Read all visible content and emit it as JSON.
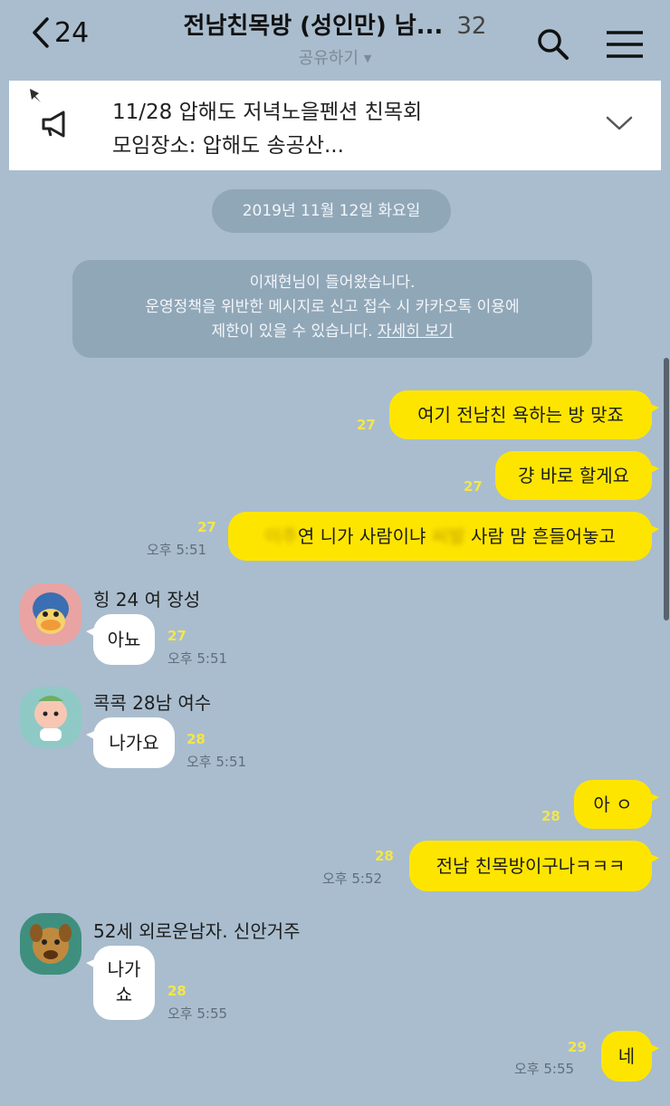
{
  "header": {
    "back_count": "24",
    "title": "전남친목방 (성인만) 남...",
    "member_count": "32",
    "share_label": "공유하기",
    "share_caret": "▼"
  },
  "notice": {
    "line1": "11/28 압해도 저녁노을펜션 친목회",
    "line2": "모임장소: 압해도 송공산..."
  },
  "date_divider": "2019년 11월 12일 화요일",
  "system_notice": {
    "line1": "이재현님이 들어왔습니다.",
    "line2": "운영정책을 위반한 메시지로 신고 접수 시 카카오톡 이용에",
    "line3_prefix": "제한이 있을 수 있습니다.",
    "line3_link": "자세히 보기"
  },
  "messages": {
    "m1": {
      "text": "여기 전남친 욕하는 방 맞죠",
      "unread": "27"
    },
    "m2": {
      "text": "걍 바로 할게요",
      "unread": "27"
    },
    "m3": {
      "blur1": "이주",
      "mid": "연 니가 사람이냐",
      "blur2": "씨발",
      "end": "사람 맘 흔들어놓고",
      "unread": "27",
      "time": "오후 5:51"
    },
    "m4": {
      "sender": "힝 24 여 장성",
      "text": "아뇨",
      "unread": "27",
      "time": "오후 5:51"
    },
    "m5": {
      "sender": "콕콕 28남 여수",
      "text": "나가요",
      "unread": "28",
      "time": "오후 5:51"
    },
    "m6": {
      "text": "아 ㅇ",
      "unread": "28"
    },
    "m7": {
      "text": "전남 친목방이구나ㅋㅋㅋ",
      "unread": "28",
      "time": "오후 5:52"
    },
    "m8": {
      "sender": "52세 외로운남자. 신안거주",
      "line1": "나가",
      "line2": "쇼",
      "unread": "28",
      "time": "오후 5:55"
    },
    "m9": {
      "text": "네",
      "unread": "29",
      "time": "오후 5:55"
    }
  },
  "colors": {
    "background": "#a9bdce",
    "my_bubble": "#fee500",
    "their_bubble": "#ffffff",
    "unread_count": "#f4e64a"
  },
  "icons": [
    "chevron-left-icon",
    "search-icon",
    "hamburger-menu-icon",
    "pin-icon",
    "megaphone-icon",
    "chevron-down-icon"
  ]
}
